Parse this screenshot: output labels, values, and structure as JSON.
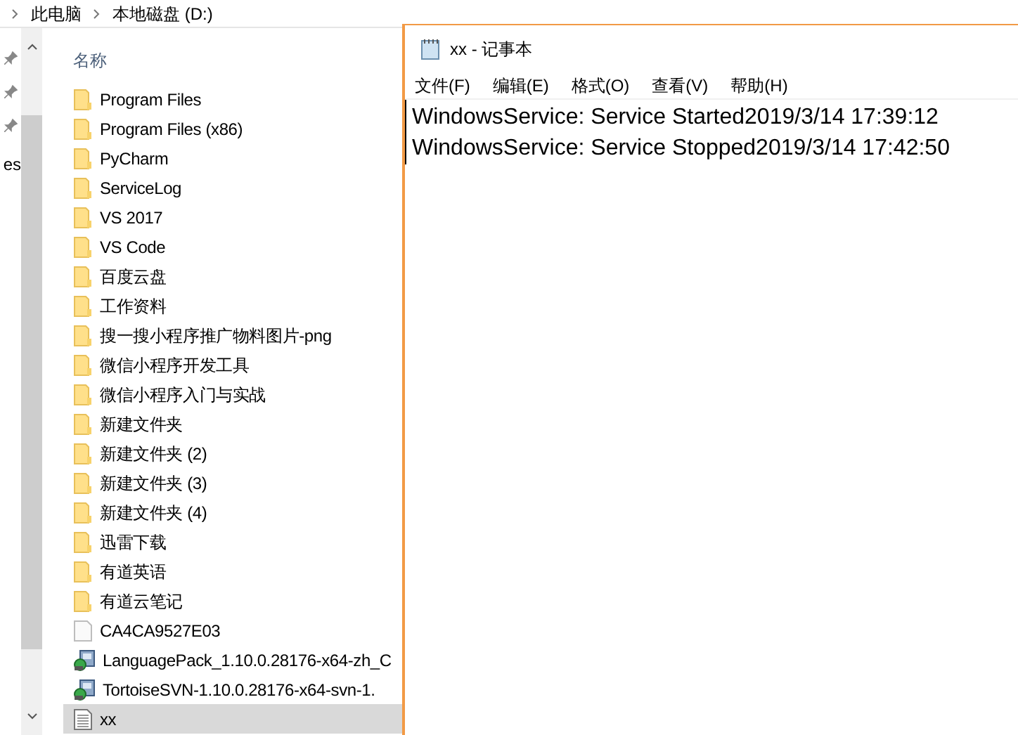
{
  "breadcrumb": [
    "此电脑",
    "本地磁盘 (D:)"
  ],
  "nav_pane": {
    "partial_label": "es"
  },
  "file_list": {
    "column_header": "名称",
    "items": [
      {
        "name": "Program Files",
        "kind": "folder",
        "selected": false
      },
      {
        "name": "Program Files (x86)",
        "kind": "folder",
        "selected": false
      },
      {
        "name": "PyCharm",
        "kind": "folder",
        "selected": false
      },
      {
        "name": "ServiceLog",
        "kind": "folder",
        "selected": false
      },
      {
        "name": "VS 2017",
        "kind": "folder",
        "selected": false
      },
      {
        "name": "VS Code",
        "kind": "folder",
        "selected": false
      },
      {
        "name": "百度云盘",
        "kind": "folder",
        "selected": false
      },
      {
        "name": "工作资料",
        "kind": "folder",
        "selected": false
      },
      {
        "name": "搜一搜小程序推广物料图片-png",
        "kind": "folder",
        "selected": false
      },
      {
        "name": "微信小程序开发工具",
        "kind": "folder",
        "selected": false
      },
      {
        "name": "微信小程序入门与实战",
        "kind": "folder",
        "selected": false
      },
      {
        "name": "新建文件夹",
        "kind": "folder",
        "selected": false
      },
      {
        "name": "新建文件夹 (2)",
        "kind": "folder",
        "selected": false
      },
      {
        "name": "新建文件夹 (3)",
        "kind": "folder",
        "selected": false
      },
      {
        "name": "新建文件夹 (4)",
        "kind": "folder",
        "selected": false
      },
      {
        "name": "迅雷下载",
        "kind": "folder",
        "selected": false
      },
      {
        "name": "有道英语",
        "kind": "folder",
        "selected": false
      },
      {
        "name": "有道云笔记",
        "kind": "folder",
        "selected": false
      },
      {
        "name": "CA4CA9527E03",
        "kind": "file",
        "selected": false
      },
      {
        "name": "LanguagePack_1.10.0.28176-x64-zh_C",
        "kind": "installer",
        "selected": false
      },
      {
        "name": "TortoiseSVN-1.10.0.28176-x64-svn-1.",
        "kind": "installer",
        "selected": false
      },
      {
        "name": "xx",
        "kind": "text",
        "selected": true
      }
    ]
  },
  "notepad": {
    "title": "xx - 记事本",
    "menu": [
      "文件(F)",
      "编辑(E)",
      "格式(O)",
      "查看(V)",
      "帮助(H)"
    ],
    "lines": [
      "WindowsService: Service Started2019/3/14 17:39:12",
      "WindowsService: Service Stopped2019/3/14 17:42:50"
    ]
  }
}
